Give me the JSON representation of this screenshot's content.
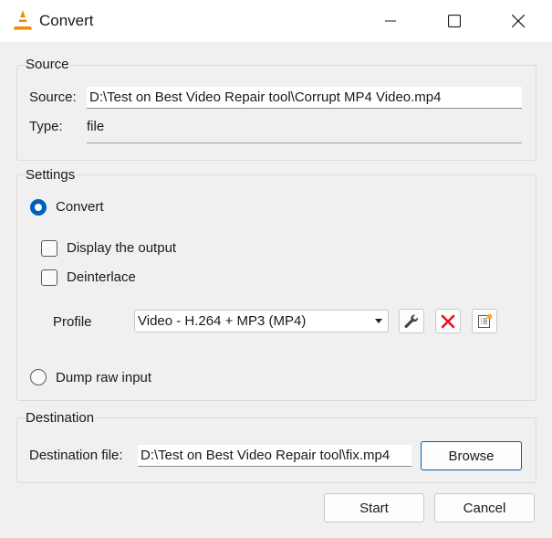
{
  "window": {
    "title": "Convert",
    "icon": "vlc-cone-icon",
    "controls": [
      "minimize-icon",
      "maximize-icon",
      "close-icon"
    ]
  },
  "source_group": {
    "title": "Source",
    "source_label": "Source:",
    "source_value": "D:\\Test on Best Video Repair tool\\Corrupt MP4 Video.mp4",
    "type_label": "Type:",
    "type_value": "file"
  },
  "settings_group": {
    "title": "Settings",
    "convert_label": "Convert",
    "convert_selected": true,
    "display_output_label": "Display the output",
    "display_output_checked": false,
    "deinterlace_label": "Deinterlace",
    "deinterlace_checked": false,
    "profile_label": "Profile",
    "profile_selected": "Video - H.264 + MP3 (MP4)",
    "profile_tools": [
      "wrench-icon",
      "delete-x-icon",
      "new-profile-icon"
    ],
    "dump_raw_label": "Dump raw input",
    "dump_raw_selected": false
  },
  "destination_group": {
    "title": "Destination",
    "dest_label": "Destination file:",
    "dest_value": "D:\\Test on Best Video Repair tool\\fix.mp4",
    "browse_label": "Browse"
  },
  "footer": {
    "start_label": "Start",
    "cancel_label": "Cancel"
  },
  "colors": {
    "accent": "#005fb8",
    "delete_red": "#e81123",
    "vlc_orange": "#f08a00"
  }
}
